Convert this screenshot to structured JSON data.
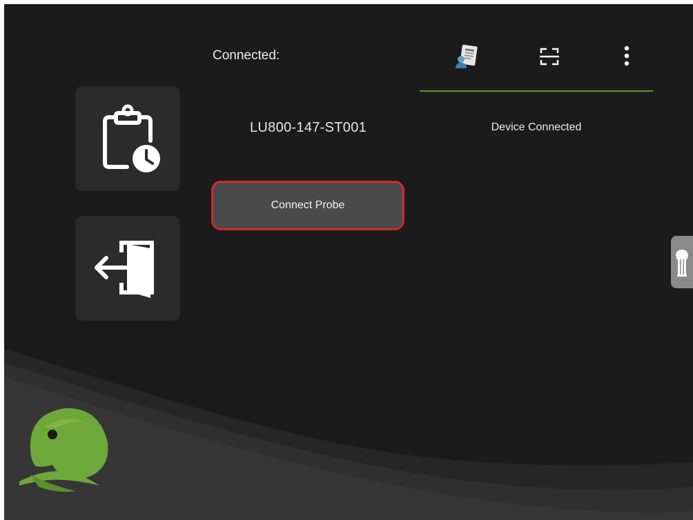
{
  "header": {
    "connected_label": "Connected:"
  },
  "device": {
    "id": "LU800-147-ST001",
    "status": "Device Connected"
  },
  "actions": {
    "connect_probe_label": "Connect Probe"
  },
  "icons": {
    "history": "clipboard-clock-icon",
    "exit": "exit-door-icon",
    "profile": "profile-card-icon",
    "scan": "scan-frame-icon",
    "more": "more-vertical-icon",
    "probe": "probe-icon",
    "logo": "chameleon-logo-icon"
  },
  "colors": {
    "background": "#1b1b1b",
    "tile": "#2b2b2b",
    "button": "#4a4a4a",
    "highlight_border": "#d4262b",
    "accent_green": "#5c9a2b",
    "probe_tab": "#8a8a8a"
  }
}
